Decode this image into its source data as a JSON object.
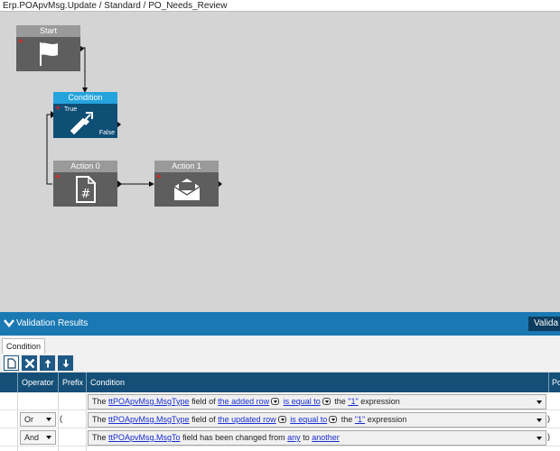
{
  "titlebar": {
    "path": "Erp.POApvMsg.Update / Standard / PO_Needs_Review"
  },
  "workflow": {
    "nodes": {
      "start": {
        "title": "Start",
        "icon": "flag-icon"
      },
      "condition": {
        "title": "Condition",
        "icon": "condition-arrows-icon",
        "true_label": "True",
        "false_label": "False"
      },
      "action0": {
        "title": "Action 0",
        "icon": "document-hash-icon"
      },
      "action1": {
        "title": "Action 1",
        "icon": "envelope-icon"
      }
    }
  },
  "validation": {
    "title": "Validation Results",
    "button_label": "Valida"
  },
  "tabs": [
    {
      "label": "Condition"
    }
  ],
  "toolbar": {
    "buttons": [
      {
        "icon": "new-document-icon"
      },
      {
        "icon": "delete-x-icon"
      },
      {
        "icon": "move-up-icon"
      },
      {
        "icon": "move-down-icon"
      }
    ]
  },
  "grid": {
    "columns": [
      "Operator",
      "Prefix",
      "Condition",
      "Po"
    ],
    "rows": [
      {
        "operator": "",
        "prefix": "",
        "condition": {
          "the": "The",
          "field_link": "ttPOApvMsg.MsgType",
          "field_of": "field of",
          "row_link": "the added row",
          "cmp_link": "is equal to",
          "the2": "the",
          "value_link": "\"1\"",
          "expr": "expression"
        },
        "postfix": ""
      },
      {
        "operator": "Or",
        "prefix": "(",
        "condition": {
          "the": "The",
          "field_link": "ttPOApvMsg.MsgType",
          "field_of": "field of",
          "row_link": "the updated row",
          "cmp_link": "is equal to",
          "the2": "the",
          "value_link": "\"1\"",
          "expr": "expression"
        },
        "postfix": ")"
      },
      {
        "operator": "And",
        "prefix": "",
        "condition": {
          "the": "The",
          "field_link": "ttPOApvMsg.MsgTo",
          "changed_text": "field has been changed from",
          "from_link": "any",
          "to_text": "to",
          "to_link": "another"
        },
        "postfix": ")"
      }
    ]
  },
  "colors": {
    "accent": "#1a79b3",
    "node_gray": "#5e5e5e",
    "node_blue": "#0f4f76",
    "header_blue": "#25a3dd",
    "link": "#1a2ed1"
  }
}
